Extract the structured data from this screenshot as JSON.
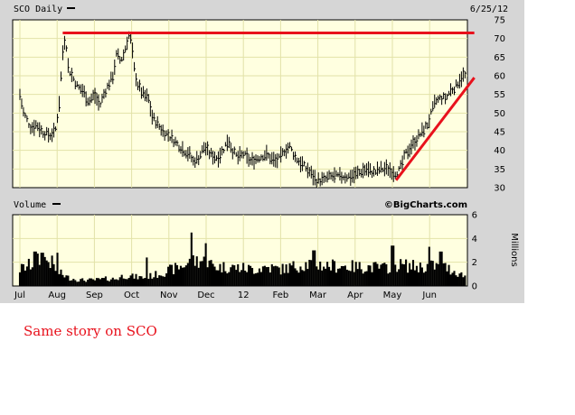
{
  "header": {
    "title": "SCO Daily",
    "date": "6/25/12",
    "volume_label": "Volume",
    "watermark": "©BigCharts.com"
  },
  "caption": "Same story on SCO",
  "colors": {
    "plot_bg": "#ffffe0",
    "grid": "#e2e2a8",
    "frame": "#d6d6d6",
    "trendline": "#e8111c",
    "bars": "#000000"
  },
  "chart_data": [
    {
      "type": "ohlc",
      "title": "SCO Daily",
      "x_ticks": [
        "Jul",
        "Aug",
        "Sep",
        "Oct",
        "Nov",
        "Dec",
        "12",
        "Feb",
        "Mar",
        "Apr",
        "May",
        "Jun"
      ],
      "x_tick_months": [
        0,
        1,
        2,
        3,
        4,
        5,
        6,
        7,
        8,
        9,
        10,
        11
      ],
      "ylim": [
        30,
        75
      ],
      "y_ticks": [
        30,
        35,
        40,
        45,
        50,
        55,
        60,
        65,
        70,
        75
      ],
      "y_axis_side": "right",
      "grid": true,
      "anchors": [
        [
          0.0,
          55
        ],
        [
          0.1,
          50
        ],
        [
          0.2,
          48
        ],
        [
          0.3,
          46
        ],
        [
          0.45,
          47
        ],
        [
          0.6,
          45
        ],
        [
          0.8,
          44
        ],
        [
          0.95,
          45
        ],
        [
          1.05,
          52
        ],
        [
          1.12,
          62
        ],
        [
          1.18,
          70
        ],
        [
          1.25,
          68
        ],
        [
          1.3,
          62
        ],
        [
          1.4,
          60
        ],
        [
          1.55,
          57
        ],
        [
          1.7,
          56
        ],
        [
          1.85,
          53
        ],
        [
          2.0,
          55
        ],
        [
          2.15,
          52
        ],
        [
          2.25,
          55
        ],
        [
          2.4,
          58
        ],
        [
          2.5,
          60
        ],
        [
          2.6,
          66
        ],
        [
          2.7,
          64
        ],
        [
          2.8,
          66
        ],
        [
          2.92,
          71
        ],
        [
          3.0,
          69
        ],
        [
          3.05,
          63
        ],
        [
          3.15,
          58
        ],
        [
          3.3,
          55
        ],
        [
          3.45,
          54
        ],
        [
          3.55,
          49
        ],
        [
          3.7,
          47
        ],
        [
          3.85,
          45
        ],
        [
          4.0,
          44
        ],
        [
          4.2,
          42
        ],
        [
          4.4,
          40
        ],
        [
          4.55,
          39
        ],
        [
          4.65,
          37
        ],
        [
          4.8,
          38
        ],
        [
          4.95,
          41
        ],
        [
          5.1,
          39
        ],
        [
          5.3,
          38
        ],
        [
          5.45,
          40
        ],
        [
          5.6,
          43
        ],
        [
          5.7,
          40
        ],
        [
          5.85,
          38
        ],
        [
          6.0,
          39
        ],
        [
          6.2,
          37
        ],
        [
          6.4,
          38
        ],
        [
          6.6,
          39
        ],
        [
          6.85,
          37
        ],
        [
          7.0,
          38
        ],
        [
          7.1,
          40
        ],
        [
          7.25,
          41
        ],
        [
          7.4,
          38
        ],
        [
          7.6,
          36
        ],
        [
          7.8,
          34
        ],
        [
          7.95,
          32
        ],
        [
          8.15,
          32
        ],
        [
          8.35,
          33
        ],
        [
          8.6,
          33
        ],
        [
          8.9,
          33
        ],
        [
          9.1,
          34
        ],
        [
          9.3,
          35
        ],
        [
          9.5,
          34
        ],
        [
          9.7,
          35
        ],
        [
          9.9,
          35
        ],
        [
          10.05,
          34
        ],
        [
          10.15,
          34
        ],
        [
          10.25,
          36
        ],
        [
          10.35,
          39
        ],
        [
          10.5,
          41
        ],
        [
          10.65,
          43
        ],
        [
          10.8,
          45
        ],
        [
          10.95,
          47
        ],
        [
          11.05,
          50
        ],
        [
          11.15,
          53
        ],
        [
          11.3,
          54
        ],
        [
          11.45,
          54
        ],
        [
          11.55,
          56
        ],
        [
          11.7,
          57
        ],
        [
          11.8,
          59
        ],
        [
          11.9,
          60
        ]
      ],
      "resistance_line": {
        "x": [
          1.15,
          12.2
        ],
        "y": [
          71.5,
          71.5
        ]
      },
      "support_trendline": {
        "x": [
          10.1,
          12.2
        ],
        "y": [
          32,
          59.5
        ]
      }
    },
    {
      "type": "bar",
      "title": "Volume",
      "ylabel": "Millions",
      "ylim": [
        0,
        6
      ],
      "y_ticks": [
        0,
        2,
        4,
        6
      ],
      "y_axis_side": "right",
      "grid": true,
      "anchors": [
        [
          0.0,
          1.4
        ],
        [
          0.3,
          1.8
        ],
        [
          0.6,
          2.3
        ],
        [
          0.85,
          2.0
        ],
        [
          1.0,
          1.2
        ],
        [
          1.3,
          0.7
        ],
        [
          1.6,
          0.5
        ],
        [
          2.0,
          0.5
        ],
        [
          2.3,
          0.6
        ],
        [
          2.6,
          0.6
        ],
        [
          2.8,
          0.9
        ],
        [
          3.0,
          0.8
        ],
        [
          3.3,
          0.7
        ],
        [
          3.6,
          0.9
        ],
        [
          3.9,
          1.2
        ],
        [
          4.2,
          1.5
        ],
        [
          4.5,
          1.9
        ],
        [
          4.8,
          2.2
        ],
        [
          5.0,
          2.0
        ],
        [
          5.3,
          1.6
        ],
        [
          5.6,
          1.6
        ],
        [
          6.0,
          1.5
        ],
        [
          6.3,
          1.4
        ],
        [
          6.6,
          1.6
        ],
        [
          7.0,
          1.4
        ],
        [
          7.3,
          1.6
        ],
        [
          7.6,
          1.8
        ],
        [
          7.9,
          1.9
        ],
        [
          8.2,
          1.7
        ],
        [
          8.6,
          1.7
        ],
        [
          9.0,
          1.6
        ],
        [
          9.4,
          1.6
        ],
        [
          9.8,
          1.5
        ],
        [
          10.1,
          1.8
        ],
        [
          10.4,
          1.7
        ],
        [
          10.8,
          1.6
        ],
        [
          11.1,
          1.7
        ],
        [
          11.4,
          1.6
        ],
        [
          11.7,
          1.2
        ],
        [
          11.9,
          0.9
        ]
      ],
      "spikes": [
        [
          4.6,
          4.5
        ],
        [
          5.0,
          3.6
        ],
        [
          3.4,
          2.4
        ],
        [
          10.0,
          3.4
        ],
        [
          11.0,
          3.3
        ],
        [
          11.3,
          2.9
        ],
        [
          7.9,
          3.0
        ],
        [
          0.4,
          2.9
        ],
        [
          0.6,
          2.8
        ],
        [
          1.0,
          2.8
        ]
      ]
    }
  ]
}
